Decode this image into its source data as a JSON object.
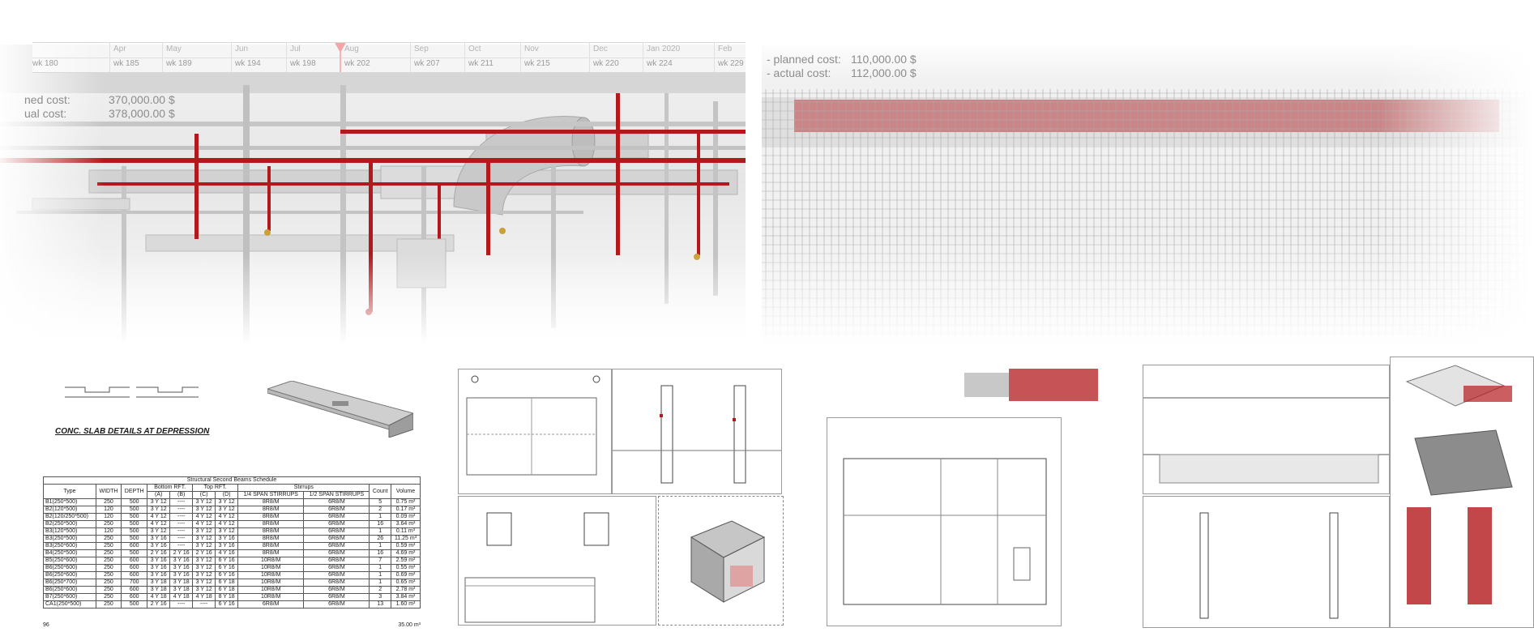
{
  "timeline": {
    "months": [
      "Apr",
      "May",
      "Jun",
      "Jul",
      "Aug",
      "Sep",
      "Oct",
      "Nov",
      "Dec",
      "Jan 2020",
      "Feb"
    ],
    "weeks": [
      "wk 180",
      "wk 185",
      "wk 189",
      "wk 194",
      "wk 198",
      "wk 202",
      "wk 207",
      "wk 211",
      "wk 215",
      "wk 220",
      "wk 224",
      "wk 229"
    ]
  },
  "mep_costs": {
    "planned_label": "ned cost:",
    "planned_value": "370,000.00 $",
    "actual_label": "ual cost:",
    "actual_value": "378,000.00 $"
  },
  "rebar_costs": {
    "planned_label": "- planned cost:",
    "planned_value": "110,000.00 $",
    "actual_label": "- actual cost:",
    "actual_value": "112,000.00 $"
  },
  "slab_details": {
    "title": "CONC. SLAB DETAILS AT DEPRESSION"
  },
  "beam_schedule": {
    "caption": "Structural Second Beams Schedule",
    "headers": {
      "type": "Type",
      "width": "WIDTH",
      "depth": "DEPTH",
      "bottom_rft": "Bottom RFT.",
      "top_rft": "Top RFT.",
      "stirrups": "Stirrups",
      "a": "(A)",
      "b": "(B)",
      "c": "(C)",
      "d": "(D)",
      "quarter_span": "1/4 SPAN STIRRUPS",
      "half_span": "1/2 SPAN STIRRUPS",
      "count": "Count",
      "volume": "Volume"
    },
    "rows": [
      [
        "B1(250*500)",
        "250",
        "500",
        "3 Y 12",
        "----",
        "3 Y 12",
        "3 Y 12",
        "8R8/M",
        "6R8/M",
        "5",
        "0.75 m³"
      ],
      [
        "B2(120*500)",
        "120",
        "500",
        "3 Y 12",
        "----",
        "3 Y 12",
        "3 Y 12",
        "8R8/M",
        "6R8/M",
        "2",
        "0.17 m³"
      ],
      [
        "B2(120/250*500)",
        "120",
        "500",
        "4 Y 12",
        "----",
        "4 Y 12",
        "4 Y 12",
        "8R8/M",
        "6R8/M",
        "1",
        "0.09 m³"
      ],
      [
        "B2(250*500)",
        "250",
        "500",
        "4 Y 12",
        "----",
        "4 Y 12",
        "4 Y 12",
        "8R8/M",
        "6R8/M",
        "16",
        "3.64 m³"
      ],
      [
        "B3(120*500)",
        "120",
        "500",
        "3 Y 12",
        "----",
        "3 Y 12",
        "3 Y 12",
        "8R8/M",
        "6R8/M",
        "1",
        "0.11 m³"
      ],
      [
        "B3(250*500)",
        "250",
        "500",
        "3 Y 16",
        "----",
        "3 Y 12",
        "3 Y 16",
        "8R8/M",
        "6R8/M",
        "26",
        "11.25 m³"
      ],
      [
        "B3(250*600)",
        "250",
        "600",
        "3 Y 16",
        "----",
        "3 Y 12",
        "3 Y 16",
        "8R8/M",
        "6R8/M",
        "1",
        "0.59 m³"
      ],
      [
        "B4(250*500)",
        "250",
        "500",
        "2 Y 16",
        "2 Y 16",
        "2 Y 16",
        "4 Y 16",
        "8R8/M",
        "6R8/M",
        "16",
        "4.69 m³"
      ],
      [
        "B5(250*600)",
        "250",
        "600",
        "3 Y 16",
        "3 Y 16",
        "3 Y 12",
        "6 Y 16",
        "10R8/M",
        "6R8/M",
        "7",
        "2.59 m³"
      ],
      [
        "B6(250*600)",
        "250",
        "600",
        "3 Y 16",
        "3 Y 16",
        "3 Y 12",
        "6 Y 16",
        "10R8/M",
        "6R8/M",
        "1",
        "0.55 m³"
      ],
      [
        "B6(250*600)",
        "250",
        "600",
        "3 Y 16",
        "3 Y 16",
        "3 Y 12",
        "6 Y 16",
        "10R8/M",
        "6R8/M",
        "1",
        "0.69 m³"
      ],
      [
        "B6(250*700)",
        "250",
        "700",
        "3 Y 18",
        "3 Y 18",
        "3 Y 12",
        "6 Y 18",
        "10R8/M",
        "6R8/M",
        "1",
        "0.65 m³"
      ],
      [
        "B6(250*600)",
        "250",
        "600",
        "3 Y 18",
        "3 Y 18",
        "3 Y 12",
        "6 Y 18",
        "10R8/M",
        "6R8/M",
        "2",
        "2.78 m³"
      ],
      [
        "B7(250*600)",
        "250",
        "600",
        "4 Y 18",
        "4 Y 18",
        "4 Y 18",
        "8 Y 18",
        "10R8/M",
        "6R8/M",
        "3",
        "3.84 m³"
      ],
      [
        "CA1(250*500)",
        "250",
        "500",
        "2 Y 16",
        "----",
        "----",
        "6 Y 16",
        "6R8/M",
        "6R8/M",
        "13",
        "1.60 m³"
      ]
    ],
    "footer_count": "96",
    "footer_volume": "35.00 m³"
  },
  "colors": {
    "pipe_red": "#b3191c",
    "duct_gray": "#cfcfcf",
    "rebar_gray": "#a5a5a5",
    "cost_text": "#8c8c8c",
    "marker_pink": "#f1a7a7"
  }
}
